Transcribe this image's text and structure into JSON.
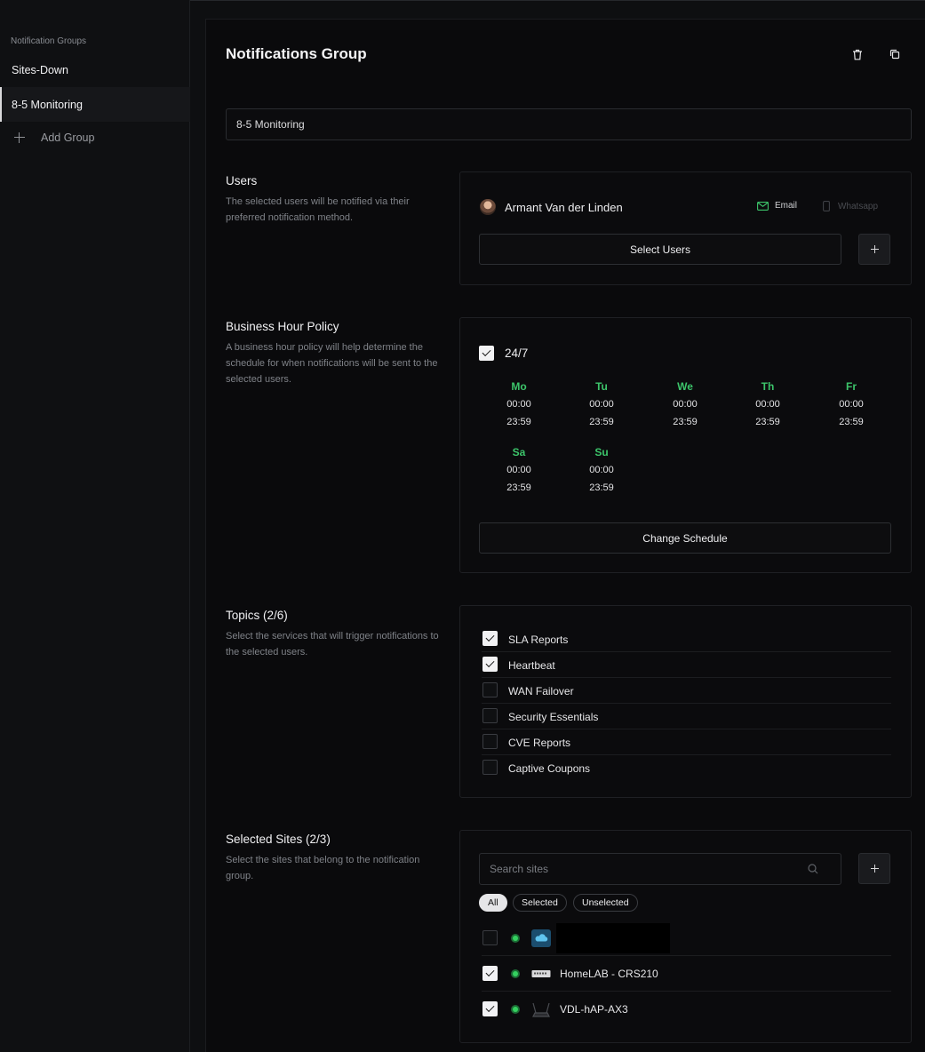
{
  "sidebar": {
    "heading": "Notification Groups",
    "items": [
      {
        "label": "Sites-Down",
        "active": false
      },
      {
        "label": "8-5 Monitoring",
        "active": true
      }
    ],
    "add_label": "Add Group"
  },
  "header": {
    "title": "Notifications Group",
    "icons": [
      "trash-icon",
      "copy-icon"
    ]
  },
  "group_name": {
    "value": "8-5 Monitoring"
  },
  "users": {
    "title": "Users",
    "description": "The selected users will be notified via their preferred notification method.",
    "list": [
      {
        "name": "Armant Van der Linden",
        "email_label": "Email",
        "whatsapp_label": "Whatsapp",
        "email_enabled": true,
        "whatsapp_enabled": false
      }
    ],
    "select_button": "Select Users"
  },
  "business_hours": {
    "title": "Business Hour Policy",
    "description": "A business hour policy will help determine the schedule for when notifications will be sent to the selected users.",
    "always_label": "24/7",
    "always_checked": true,
    "days": [
      {
        "name": "Mo",
        "start": "00:00",
        "end": "23:59"
      },
      {
        "name": "Tu",
        "start": "00:00",
        "end": "23:59"
      },
      {
        "name": "We",
        "start": "00:00",
        "end": "23:59"
      },
      {
        "name": "Th",
        "start": "00:00",
        "end": "23:59"
      },
      {
        "name": "Fr",
        "start": "00:00",
        "end": "23:59"
      },
      {
        "name": "Sa",
        "start": "00:00",
        "end": "23:59"
      },
      {
        "name": "Su",
        "start": "00:00",
        "end": "23:59"
      }
    ],
    "day_color": "#3cc46a",
    "change_button": "Change Schedule"
  },
  "topics": {
    "title": "Topics (2/6)",
    "description": "Select the services that will trigger notifications to the selected users.",
    "items": [
      {
        "label": "SLA Reports",
        "checked": true
      },
      {
        "label": "Heartbeat",
        "checked": true
      },
      {
        "label": "WAN Failover",
        "checked": false
      },
      {
        "label": "Security Essentials",
        "checked": false
      },
      {
        "label": "CVE Reports",
        "checked": false
      },
      {
        "label": "Captive Coupons",
        "checked": false
      }
    ]
  },
  "sites": {
    "title": "Selected Sites (2/3)",
    "description": "Select the sites that belong to the notification group.",
    "search_placeholder": "Search sites",
    "filters": [
      {
        "label": "All",
        "active": true
      },
      {
        "label": "Selected",
        "active": false
      },
      {
        "label": "Unselected",
        "active": false
      }
    ],
    "items": [
      {
        "name": "",
        "checked": false,
        "status": "online",
        "icon": "cloud-icon",
        "redacted": true
      },
      {
        "name": "HomeLAB - CRS210",
        "checked": true,
        "status": "online",
        "icon": "switch-icon",
        "redacted": false
      },
      {
        "name": "VDL-hAP-AX3",
        "checked": true,
        "status": "online",
        "icon": "router-icon",
        "redacted": false
      }
    ],
    "status_color": "#34d05f"
  }
}
